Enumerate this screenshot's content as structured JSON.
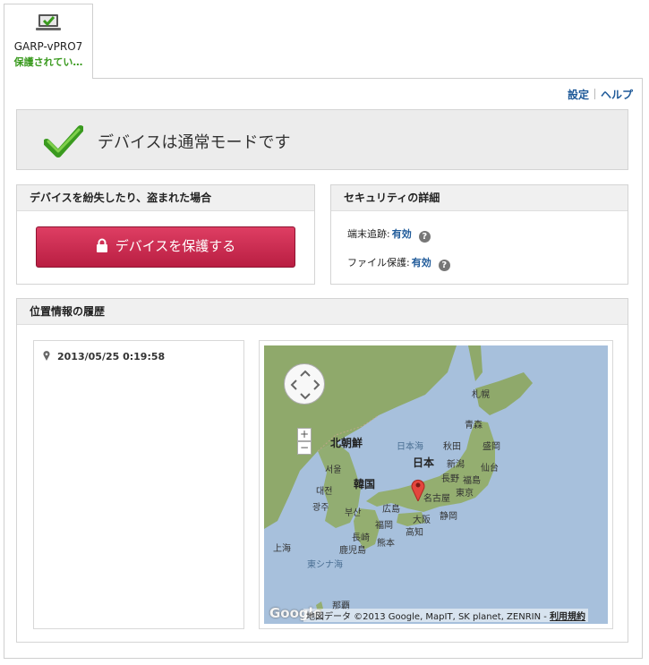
{
  "device_tab": {
    "name": "GARP-vPRO7",
    "status": "保護されてい…"
  },
  "top_links": {
    "settings": "設定",
    "help": "ヘルプ"
  },
  "mode": {
    "text": "デバイスは通常モードです"
  },
  "lost_panel": {
    "title": "デバイスを紛失したり、盗まれた場合",
    "protect_button": "デバイスを保護する"
  },
  "security_panel": {
    "title": "セキュリティの詳細",
    "rows": [
      {
        "label": "端末追跡:",
        "value": "有効",
        "help": "?"
      },
      {
        "label": "ファイル保護:",
        "value": "有効",
        "help": "?"
      }
    ]
  },
  "history_panel": {
    "title": "位置情報の履歴",
    "entries": [
      "2013/05/25 0:19:58"
    ]
  },
  "map": {
    "labels": [
      "札幌",
      "青森",
      "秋田",
      "盛岡",
      "新潟",
      "仙台",
      "長野",
      "福島",
      "東京",
      "静岡",
      "名古屋",
      "大阪",
      "高知",
      "広島",
      "福岡",
      "長崎",
      "熊本",
      "鹿児島",
      "上海",
      "那覇"
    ],
    "country_labels": [
      "北朝鮮",
      "韓国",
      "日本"
    ],
    "sea_labels": [
      "日本海",
      "東シナ海"
    ],
    "korean_labels": [
      "서울",
      "대전",
      "광주",
      "부산"
    ],
    "google_logo": "Google",
    "attribution": "地図データ ©2013 Google, MapIT, SK planet, ZENRIN -",
    "terms_link": "利用規約",
    "zoom_in": "+",
    "zoom_out": "−"
  },
  "colors": {
    "accent_link": "#1f5a99",
    "status_green": "#3a9a1f",
    "protect_button": "#c8284f",
    "sea": "#a7c0dc",
    "land": "#8fa96b"
  }
}
